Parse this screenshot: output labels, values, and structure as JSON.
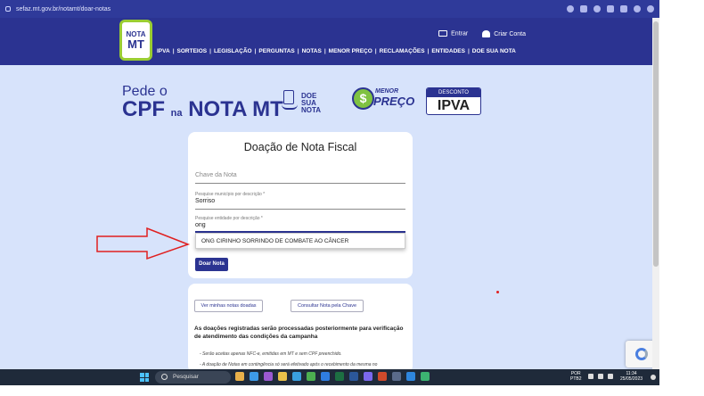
{
  "browser": {
    "url": "sefaz.mt.gov.br/notamt/doar-notas",
    "icons": [
      "google-icon",
      "share-icon",
      "star-icon",
      "extension-icon",
      "sidebar-icon",
      "profile-icon",
      "menu-icon"
    ]
  },
  "header": {
    "logo_line1": "NOTA",
    "logo_line2": "MT",
    "enter_label": "Entrar",
    "create_account_label": "Criar Conta",
    "nav": [
      "IPVA",
      "SORTEIOS",
      "LEGISLAÇÃO",
      "PERGUNTAS",
      "NOTAS",
      "MENOR PREÇO",
      "RECLAMAÇÕES",
      "ENTIDADES",
      "DOE SUA NOTA"
    ],
    "nav_separator": "|"
  },
  "banner": {
    "pede": "Pede o",
    "cpf": "CPF",
    "na": "na",
    "nota_mt": "NOTA MT",
    "doe_line1": "DOE SUA",
    "doe_line2": "NOTA",
    "menor": "MENOR",
    "preco": "PREÇO",
    "desconto": "DESCONTO",
    "ipva": "IPVA"
  },
  "form": {
    "title": "Doação de Nota Fiscal",
    "chave_placeholder": "Chave da Nota",
    "municipio_label": "Pesquise município por descrição *",
    "municipio_value": "Sorriso",
    "entidade_label": "Pesquise entidade por descrição *",
    "entidade_value": "ong",
    "autocomplete_option": "ONG CIRINHO SORRINDO DE COMBATE AO CÂNCER",
    "submit_label": "Doar Nota"
  },
  "info": {
    "btn_minhas": "Ver minhas notas doadas",
    "btn_consultar": "Consultar Nota pela Chave",
    "title": "As doações registradas serão processadas posteriormente para verificação de atendimento das condições da campanha",
    "line1": "- Serão aceitas apenas NFC-e, emitidas em MT e sem CPF preenchido.",
    "line2": "- A doação de Notas em contingência só será efetivado após o recebimento da mesma no"
  },
  "taskbar": {
    "search_placeholder": "Pesquisar",
    "lang1": "POR",
    "lang2": "PTB2",
    "time": "11:34",
    "date": "25/05/2023"
  },
  "colors": {
    "brand": "#2b3391",
    "accent_green": "#9acd32",
    "page_bg": "#d7e3fb",
    "arrow": "#e02020"
  }
}
